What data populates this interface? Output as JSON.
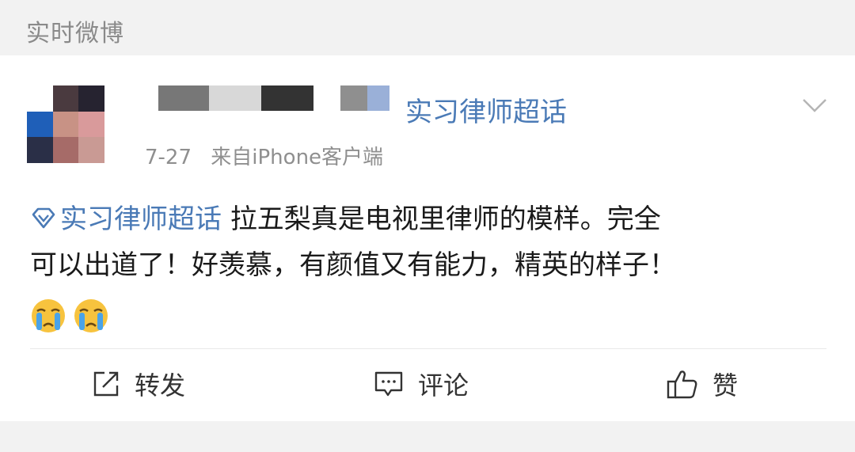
{
  "section": {
    "title": "实时微博"
  },
  "post": {
    "topic_tag": "实习律师超话",
    "time": "7-27",
    "source": "来自iPhone客户端",
    "supertopic_link": "实习律师超话",
    "text_line1": "拉五梨真是电视里律师的模样。完全",
    "text_line2": "可以出道了！好羡慕，有颜值又有能力，精英的样子！",
    "emojis": [
      "crying-face-icon",
      "crying-face-icon"
    ]
  },
  "actions": {
    "repost_label": "转发",
    "comment_label": "评论",
    "like_label": "赞"
  },
  "colors": {
    "link": "#4a7ab6",
    "meta": "#8f8f8f",
    "header_bg": "#f2f2f2",
    "card_bg": "#ffffff"
  }
}
